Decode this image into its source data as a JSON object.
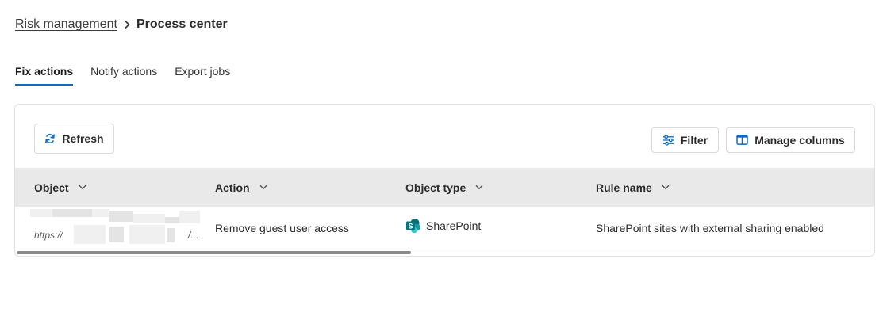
{
  "breadcrumb": {
    "parent": "Risk management",
    "current": "Process center"
  },
  "tabs": [
    {
      "label": "Fix actions",
      "active": true
    },
    {
      "label": "Notify actions",
      "active": false
    },
    {
      "label": "Export jobs",
      "active": false
    }
  ],
  "toolbar": {
    "refresh_label": "Refresh",
    "filter_label": "Filter",
    "manage_columns_label": "Manage columns"
  },
  "table": {
    "columns": [
      "Object",
      "Action",
      "Object type",
      "Rule name"
    ],
    "rows": [
      {
        "object_prefix": "https://",
        "object_suffix": "/...",
        "action": "Remove guest user access",
        "object_type": "SharePoint",
        "rule_name": "SharePoint sites with external sharing enabled"
      }
    ]
  },
  "colors": {
    "accent": "#0f6cbd",
    "sharepoint": "#038387",
    "header_bg": "#e9e9e9"
  },
  "icons": {
    "refresh": "refresh-icon",
    "filter": "filter-icon",
    "columns": "columns-icon",
    "sort": "chevron-down-icon",
    "sharepoint": "sharepoint-icon"
  }
}
